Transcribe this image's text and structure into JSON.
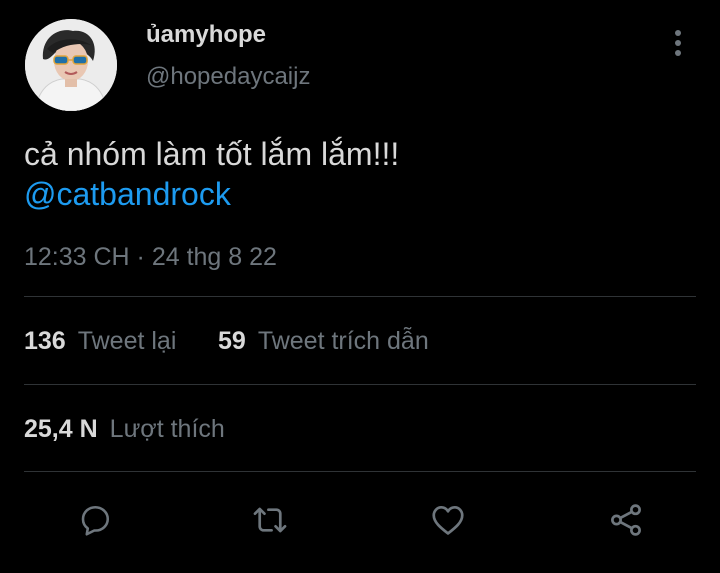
{
  "author": {
    "display_name": "ủamyhope",
    "handle": "@hopedaycaijz"
  },
  "tweet": {
    "text": "cả nhóm làm tốt lắm lắm!!!",
    "mention": "@catbandrock",
    "timestamp": "12:33 CH · 24 thg 8 22"
  },
  "stats": {
    "retweets_count": "136",
    "retweets_label": "Tweet lại",
    "quotes_count": "59",
    "quotes_label": "Tweet trích dẫn",
    "likes_count": "25,4 N",
    "likes_label": "Lượt thích"
  },
  "actions": [
    "reply-icon",
    "retweet-icon",
    "like-icon",
    "share-icon"
  ],
  "colors": {
    "background": "#000000",
    "text_primary": "#d9d9d9",
    "text_secondary": "#6e767d",
    "accent": "#1d9bf0",
    "divider": "#2f3336"
  }
}
